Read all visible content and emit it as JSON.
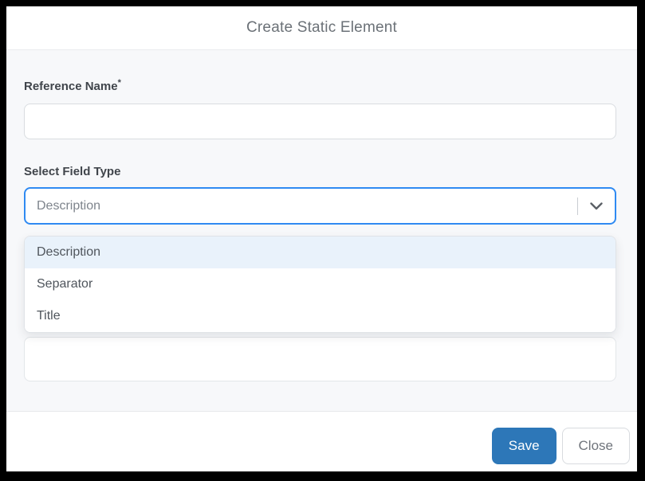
{
  "modal": {
    "title": "Create Static Element",
    "fields": {
      "reference_name": {
        "label": "Reference Name",
        "required_marker": "*",
        "value": ""
      },
      "field_type": {
        "label": "Select Field Type",
        "selected_value": "Description",
        "options": [
          "Description",
          "Separator",
          "Title"
        ],
        "highlighted_option": "Description"
      },
      "description_text": {
        "value": ""
      }
    },
    "footer": {
      "save_label": "Save",
      "close_label": "Close"
    }
  },
  "colors": {
    "frame_black": "#000000",
    "focus_blue": "#2f8af2",
    "save_blue": "#2d77b8",
    "option_highlight": "#e9f2fb",
    "body_bg": "#f7f8fa"
  }
}
